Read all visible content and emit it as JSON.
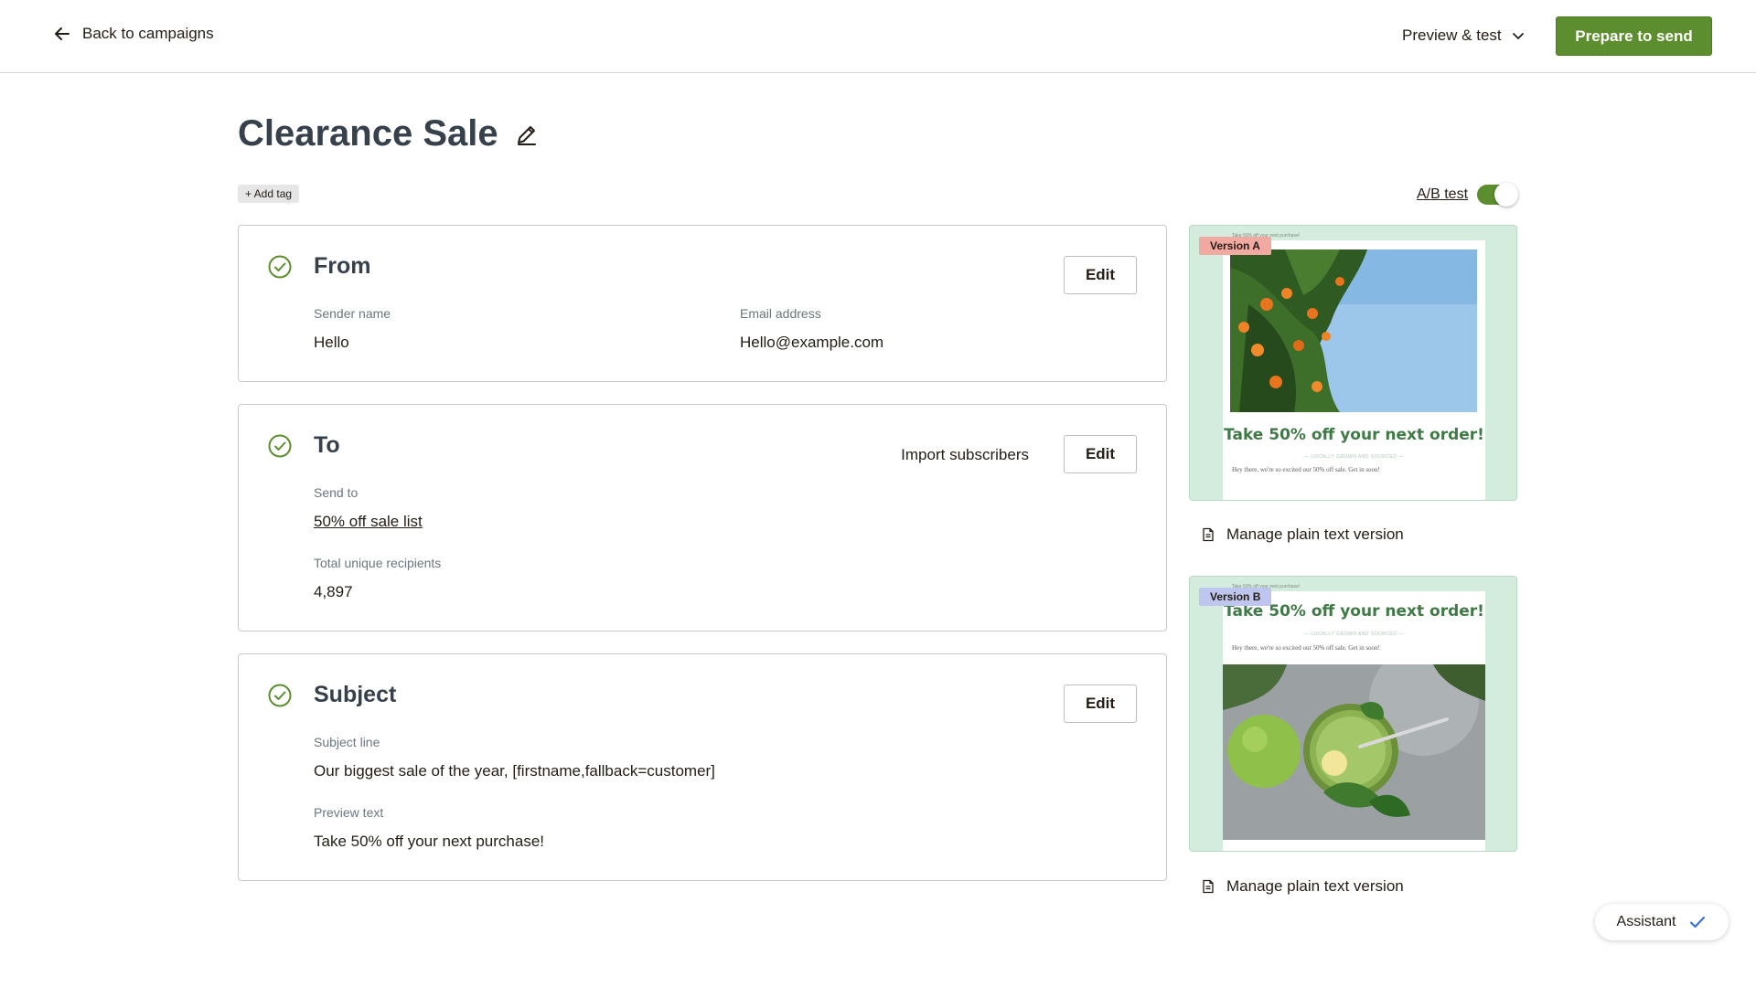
{
  "header": {
    "back_label": "Back to campaigns",
    "preview_label": "Preview & test",
    "prepare_label": "Prepare to send"
  },
  "campaign": {
    "title": "Clearance Sale",
    "add_tag_label": "+ Add tag"
  },
  "ab_test": {
    "label": "A/B test",
    "enabled": true
  },
  "from": {
    "title": "From",
    "edit_label": "Edit",
    "sender_name_label": "Sender name",
    "sender_name_value": "Hello",
    "email_label": "Email address",
    "email_value": "Hello@example.com"
  },
  "to": {
    "title": "To",
    "import_label": "Import subscribers",
    "edit_label": "Edit",
    "send_to_label": "Send to",
    "send_to_value": "50% off sale list",
    "recipients_label": "Total unique recipients",
    "recipients_value": "4,897"
  },
  "subject": {
    "title": "Subject",
    "edit_label": "Edit",
    "subject_line_label": "Subject line",
    "subject_line_value": "Our biggest sale of the year, [firstname,fallback=customer]",
    "preview_text_label": "Preview text",
    "preview_text_value": "Take 50% off your next purchase!"
  },
  "versions": [
    {
      "badge": "Version A",
      "preheader": "Take 50% off your next purchase!",
      "headline": "Take 50% off your next order!",
      "tagline": "— LOCALLY GROWN AND SOURCED —",
      "body": "Hey there, we're so excited our 50% off sale. Get in soon!",
      "plain_text_label": "Manage plain text version"
    },
    {
      "badge": "Version B",
      "preheader": "Take 50% off your next purchase!",
      "headline": "Take 50% off your next order!",
      "tagline": "— LOCALLY GROWN AND SOURCED —",
      "body": "Hey there, we're so excited our 50% off sale. Get in soon!",
      "plain_text_label": "Manage plain text version"
    }
  ],
  "assistant": {
    "label": "Assistant"
  },
  "colors": {
    "accent": "#5c8d2e",
    "preview_bg": "#d4ecdd",
    "badge_a": "#f2a9a1",
    "badge_b": "#bec6f0"
  }
}
